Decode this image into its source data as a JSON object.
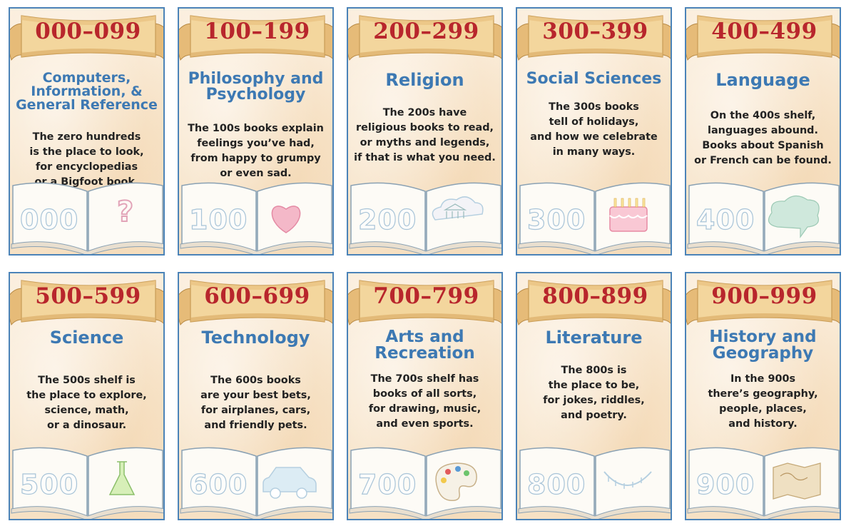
{
  "colors": {
    "border": "#4b83b8",
    "range": "#b8262c",
    "category": "#3d79b3",
    "text": "#222222",
    "parchment": "#f8e6cd",
    "scroll": "#f0cf94"
  },
  "posters": [
    {
      "range": "000–099",
      "category_lines": [
        "Computers,",
        "Information, &",
        "General Reference"
      ],
      "desc_lines": [
        "The zero hundreds",
        "is the place to look,",
        "for encyclopedias",
        "or a Bigfoot book."
      ],
      "book_number": "000",
      "icon": "question-mark-icon"
    },
    {
      "range": "100–199",
      "category_lines": [
        "Philosophy and",
        "Psychology"
      ],
      "desc_lines": [
        "The 100s books explain",
        "feelings you’ve had,",
        "from happy to grumpy",
        "or even sad."
      ],
      "book_number": "100",
      "icon": "heart-icon"
    },
    {
      "range": "200–299",
      "category_lines": [
        "Religion"
      ],
      "desc_lines": [
        "The 200s have",
        "religious books to read,",
        "or myths and legends,",
        "if that is what you need."
      ],
      "book_number": "200",
      "icon": "temple-cloud-icon"
    },
    {
      "range": "300–399",
      "category_lines": [
        "Social Sciences"
      ],
      "desc_lines": [
        "The 300s books",
        "tell of holidays,",
        "and how we celebrate",
        "in many ways."
      ],
      "book_number": "300",
      "icon": "birthday-cake-icon"
    },
    {
      "range": "400–499",
      "category_lines": [
        "Language"
      ],
      "desc_lines": [
        "On the 400s shelf,",
        "languages abound.",
        "Books about Spanish",
        "or French can be found."
      ],
      "book_number": "400",
      "icon": "speech-bubble-icon"
    },
    {
      "range": "500–599",
      "category_lines": [
        "Science"
      ],
      "desc_lines": [
        "The 500s shelf is",
        "the place to explore,",
        "science, math,",
        "or a dinosaur."
      ],
      "book_number": "500",
      "icon": "flask-icon"
    },
    {
      "range": "600–699",
      "category_lines": [
        "Technology"
      ],
      "desc_lines": [
        "The 600s books",
        "are your best bets,",
        "for airplanes, cars,",
        "and friendly pets."
      ],
      "book_number": "600",
      "icon": "car-icon"
    },
    {
      "range": "700–799",
      "category_lines": [
        "Arts and",
        "Recreation"
      ],
      "desc_lines": [
        "The 700s shelf has",
        "books of all sorts,",
        "for drawing, music,",
        "and even sports."
      ],
      "book_number": "700",
      "icon": "paint-palette-icon"
    },
    {
      "range": "800–899",
      "category_lines": [
        "Literature"
      ],
      "desc_lines": [
        "The 800s is",
        "the place to be,",
        "for jokes, riddles,",
        "and poetry."
      ],
      "book_number": "800",
      "icon": "smile-mouth-icon"
    },
    {
      "range": "900–999",
      "category_lines": [
        "History and",
        "Geography"
      ],
      "desc_lines": [
        "In the 900s",
        "there’s geography,",
        "people, places,",
        "and history."
      ],
      "book_number": "900",
      "icon": "map-icon"
    }
  ]
}
